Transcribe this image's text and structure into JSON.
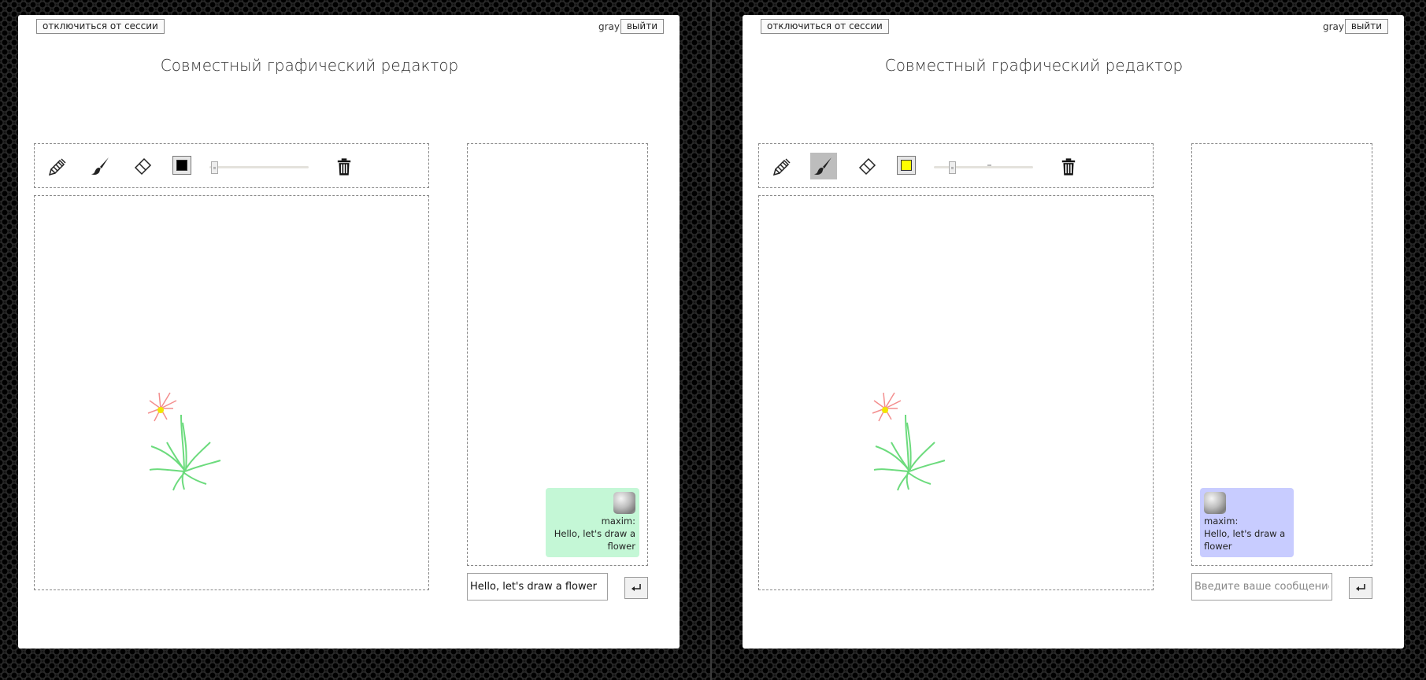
{
  "left": {
    "disconnect_label": "отключиться от сессии",
    "username": "gray",
    "logout_label": "выйти",
    "title": "Совместный графический редактор",
    "active_tool": "none",
    "brush_color": "#000000",
    "brush_size_fraction": 0.05,
    "message": {
      "author": "maxim:",
      "text": "Hello, let's draw a flower",
      "color": "#c4f7d6",
      "align": "right"
    },
    "chat_input_value": "Hello, let's draw a flower",
    "chat_input_placeholder": ""
  },
  "right": {
    "disconnect_label": "отключиться от сессии",
    "username": "gray",
    "logout_label": "выйти",
    "title": "Совместный графический редактор",
    "active_tool": "brush",
    "brush_color": "#ffff00",
    "brush_size_fraction": 0.18,
    "message": {
      "author": "maxim:",
      "text": "Hello, let's draw a flower",
      "color": "#c8ccff",
      "align": "left"
    },
    "chat_input_value": "",
    "chat_input_placeholder": "Введите ваше сообщение..."
  },
  "icons": {
    "tools": [
      "pencil-icon",
      "brush-icon",
      "eraser-icon"
    ],
    "clear": "trash-icon",
    "send": "enter-arrow-icon"
  }
}
